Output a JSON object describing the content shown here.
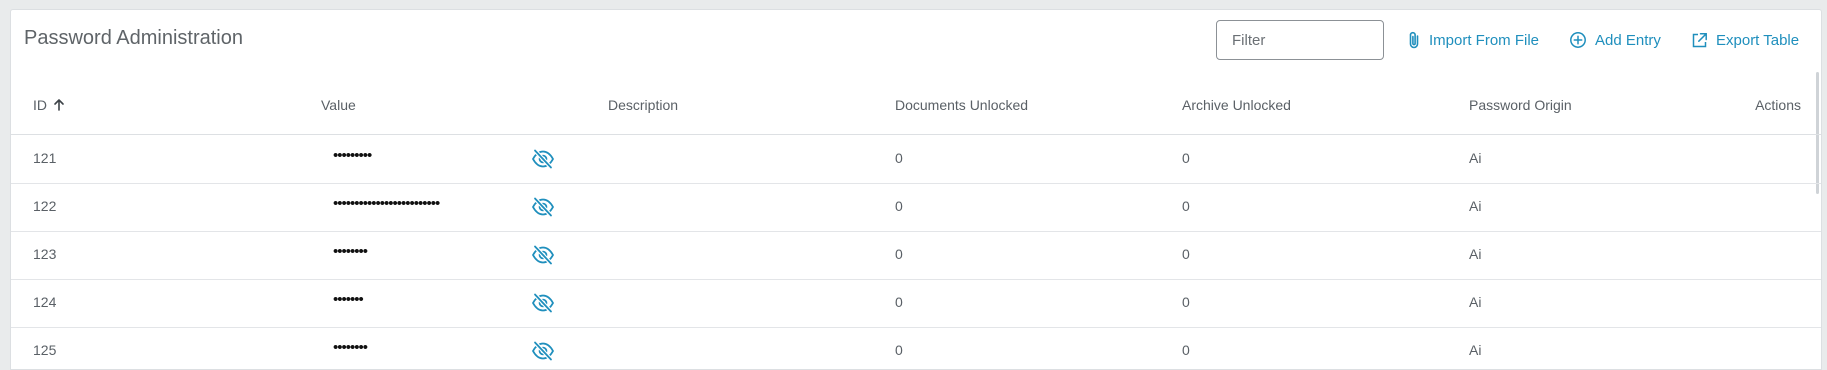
{
  "header": {
    "title": "Password Administration",
    "filter_placeholder": "Filter",
    "filter_value": "",
    "import_label": "Import From File",
    "add_label": "Add Entry",
    "export_label": "Export Table"
  },
  "columns": {
    "id": "ID",
    "value": "Value",
    "description": "Description",
    "documents_unlocked": "Documents Unlocked",
    "archive_unlocked": "Archive Unlocked",
    "password_origin": "Password Origin",
    "actions": "Actions"
  },
  "sort": {
    "column": "id",
    "direction": "ascending",
    "icon": "arrow-up-icon"
  },
  "rows": [
    {
      "id": "121",
      "value": "•••••••••",
      "description": "",
      "documents_unlocked": "0",
      "archive_unlocked": "0",
      "password_origin": "Ai"
    },
    {
      "id": "122",
      "value": "•••••••••••••••••••••••••",
      "description": "",
      "documents_unlocked": "0",
      "archive_unlocked": "0",
      "password_origin": "Ai"
    },
    {
      "id": "123",
      "value": "••••••••",
      "description": "",
      "documents_unlocked": "0",
      "archive_unlocked": "0",
      "password_origin": "Ai"
    },
    {
      "id": "124",
      "value": "•••••••",
      "description": "",
      "documents_unlocked": "0",
      "archive_unlocked": "0",
      "password_origin": "Ai"
    },
    {
      "id": "125",
      "value": "••••••••",
      "description": "",
      "documents_unlocked": "0",
      "archive_unlocked": "0",
      "password_origin": "Ai"
    }
  ],
  "colors": {
    "accent": "#1f8fbd",
    "text": "#5a6066",
    "border": "#dde0e3",
    "background": "#e9ebec"
  }
}
